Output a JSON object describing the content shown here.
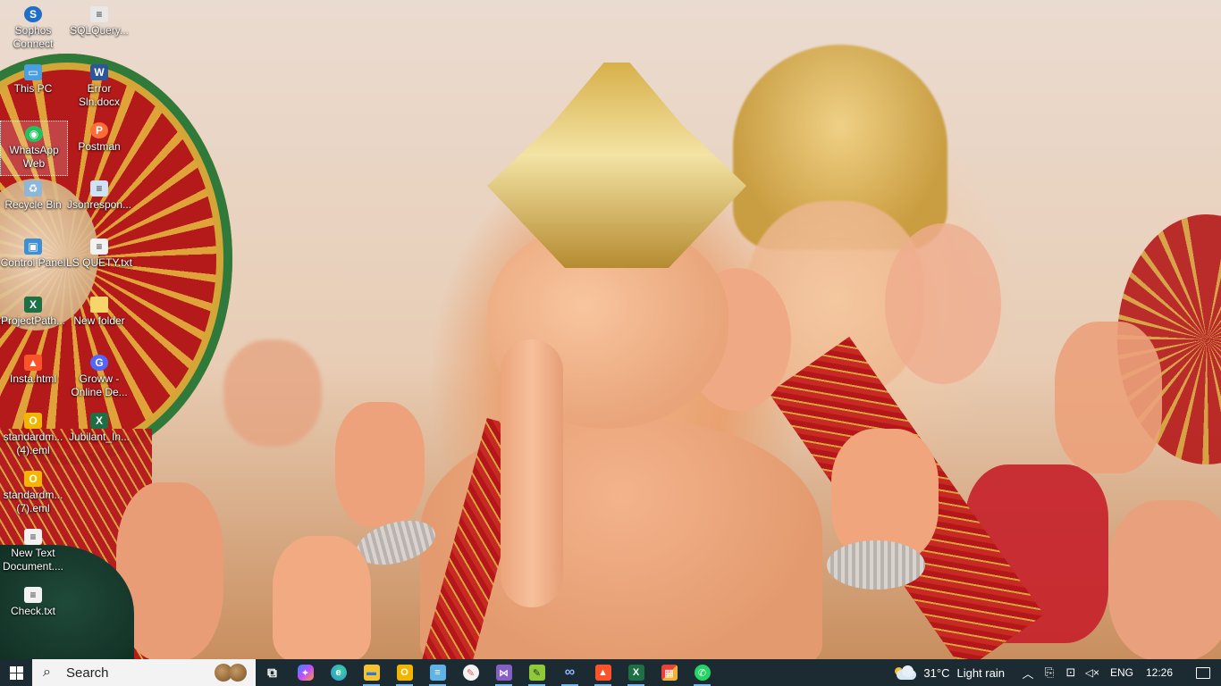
{
  "desktop": {
    "icons": [
      {
        "label": "Sophos Connect",
        "icon": "sophos-connect-icon",
        "color": "#1f6fc9",
        "glyph": "S"
      },
      {
        "label": "SQLQuery...",
        "icon": "sql-file-icon",
        "color": "#e8e8e8",
        "glyph": "≡"
      },
      {
        "label": "This PC",
        "icon": "computer-icon",
        "color": "#4a9fe0",
        "glyph": "▭"
      },
      {
        "label": "Error Sln.docx",
        "icon": "word-doc-icon",
        "color": "#2b579a",
        "glyph": "W"
      },
      {
        "label": "WhatsApp Web",
        "icon": "whatsapp-web-icon",
        "color": "#22c35e",
        "glyph": "◉"
      },
      {
        "label": "Postman",
        "icon": "postman-icon",
        "color": "#ff6c37",
        "glyph": "P"
      },
      {
        "label": "Recycle Bin",
        "icon": "recycle-bin-icon",
        "color": "#8db7d8",
        "glyph": "♻"
      },
      {
        "label": "Jsonrespon...",
        "icon": "text-file-icon",
        "color": "#cfe3f5",
        "glyph": "≡"
      },
      {
        "label": "Control Panel",
        "icon": "control-panel-icon",
        "color": "#3d8fd6",
        "glyph": "▣"
      },
      {
        "label": "LS QUETY.txt",
        "icon": "text-file-icon",
        "color": "#f2f2f2",
        "glyph": "≡"
      },
      {
        "label": "ProjectPath...",
        "icon": "excel-file-icon",
        "color": "#1d7044",
        "glyph": "X"
      },
      {
        "label": "New folder",
        "icon": "folder-icon",
        "color": "#f7d56b",
        "glyph": ""
      },
      {
        "label": "Insta.html",
        "icon": "brave-html-icon",
        "color": "#fb542b",
        "glyph": "▲"
      },
      {
        "label": "Groww - Online De...",
        "icon": "groww-icon",
        "color": "#5367ff",
        "glyph": "G"
      },
      {
        "label": "standardm... (4).eml",
        "icon": "outlook-eml-icon",
        "color": "#f2b600",
        "glyph": "O"
      },
      {
        "label": "Jubilant_In...",
        "icon": "excel-file-icon",
        "color": "#1d7044",
        "glyph": "X"
      },
      {
        "label": "standardm... (7).eml",
        "icon": "outlook-eml-icon",
        "color": "#f2b600",
        "glyph": "O"
      },
      {
        "label": "New Text Document....",
        "icon": "text-file-icon",
        "color": "#f2f2f2",
        "glyph": "≡"
      },
      {
        "label": "Check.txt",
        "icon": "text-file-icon",
        "color": "#f2f2f2",
        "glyph": "≡"
      }
    ]
  },
  "taskbar": {
    "search_placeholder": "Search",
    "apps": [
      {
        "name": "task-view",
        "icon": "task-view-icon",
        "color": "#1c2a32",
        "glyph": "⧉",
        "active": false
      },
      {
        "name": "copilot",
        "icon": "copilot-icon",
        "color": "#7c5cff",
        "glyph": "✦",
        "active": false
      },
      {
        "name": "edge",
        "icon": "edge-browser-icon",
        "color": "#2c8fe0",
        "glyph": "e",
        "active": false
      },
      {
        "name": "file-explorer",
        "icon": "file-explorer-icon",
        "color": "#f5c232",
        "glyph": "▬",
        "active": true
      },
      {
        "name": "outlook",
        "icon": "outlook-icon",
        "color": "#f2b600",
        "glyph": "O",
        "active": true
      },
      {
        "name": "notepad",
        "icon": "notepad-icon",
        "color": "#5fb3e8",
        "glyph": "≡",
        "active": true
      },
      {
        "name": "paint",
        "icon": "paint-icon",
        "color": "#e45b5b",
        "glyph": "✎",
        "active": false
      },
      {
        "name": "visual-studio",
        "icon": "visual-studio-icon",
        "color": "#865fc5",
        "glyph": "⋈",
        "active": true
      },
      {
        "name": "notepad-plus",
        "icon": "notepad-plus-icon",
        "color": "#8fc93a",
        "glyph": "✎",
        "active": true
      },
      {
        "name": "infinity-app",
        "icon": "infinity-icon",
        "color": "#1c2a32",
        "glyph": "∞",
        "active": true
      },
      {
        "name": "brave",
        "icon": "brave-browser-icon",
        "color": "#fb542b",
        "glyph": "▲",
        "active": true
      },
      {
        "name": "excel",
        "icon": "excel-icon",
        "color": "#1d7044",
        "glyph": "X",
        "active": true
      },
      {
        "name": "sticky-app",
        "icon": "grid-app-icon",
        "color": "#d88c2a",
        "glyph": "▦",
        "active": false
      },
      {
        "name": "whatsapp",
        "icon": "whatsapp-icon",
        "color": "#25d366",
        "glyph": "✆",
        "active": true
      }
    ],
    "weather": {
      "temp": "31°C",
      "condition": "Light rain"
    },
    "tray_icons": [
      {
        "name": "show-hidden-icons",
        "glyph": "︿"
      },
      {
        "name": "meet-now-icon",
        "glyph": "⎘"
      },
      {
        "name": "network-icon",
        "glyph": "⊡"
      },
      {
        "name": "volume-muted-icon",
        "glyph": "🔇"
      }
    ],
    "language": "ENG",
    "time": "12:26",
    "notification_glyph": "▭"
  }
}
